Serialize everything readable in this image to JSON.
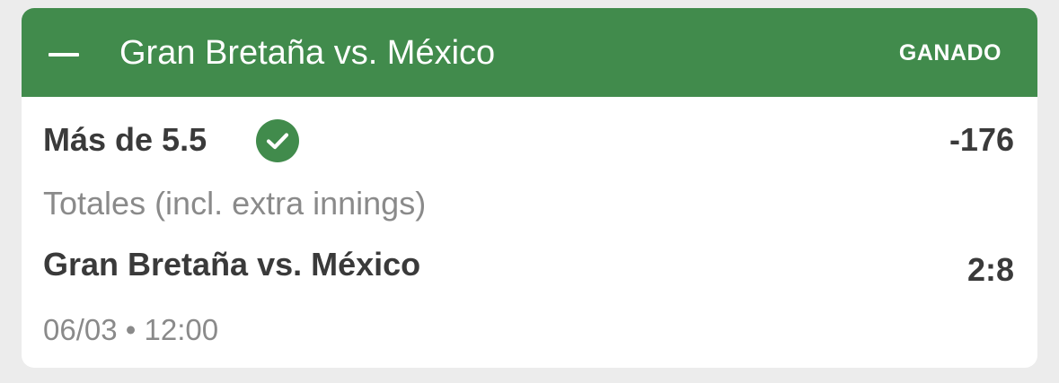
{
  "header": {
    "title": "Gran Bretaña vs. México",
    "status": "GANADO",
    "collapse_icon": "minus-icon"
  },
  "bet": {
    "selection": "Más de 5.5",
    "result_icon": "check-circle-icon",
    "odds": "-176",
    "market": "Totales (incl. extra innings)",
    "event": "Gran Bretaña vs. México",
    "score": "2:8",
    "date": "06/03",
    "separator": "•",
    "time": "12:00"
  },
  "colors": {
    "header_bg": "#418b4c",
    "check_bg": "#418b4c",
    "primary_text": "#3a3a3a",
    "secondary_text": "#8a8a8a"
  }
}
